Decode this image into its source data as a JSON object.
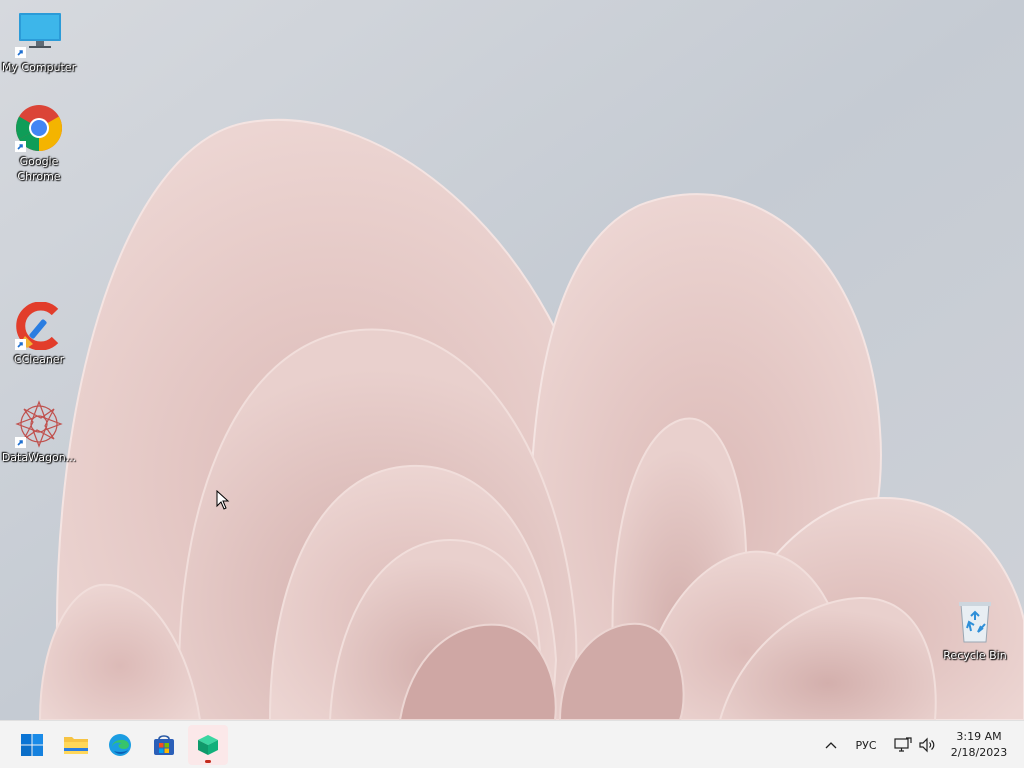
{
  "desktop": {
    "icons": [
      {
        "label": "My Computer",
        "icon": "monitor-icon"
      },
      {
        "label": "Google Chrome",
        "icon": "chrome-icon"
      },
      {
        "label": "CCleaner",
        "icon": "ccleaner-icon"
      },
      {
        "label": "DataWagon...",
        "icon": "datawagon-icon"
      },
      {
        "label": "Recycle Bin",
        "icon": "recycle-bin-icon"
      }
    ]
  },
  "taskbar": {
    "pinned": [
      {
        "name": "start",
        "icon": "windows-start-icon"
      },
      {
        "name": "file-explorer",
        "icon": "folder-icon"
      },
      {
        "name": "edge",
        "icon": "edge-icon"
      },
      {
        "name": "store",
        "icon": "store-icon"
      },
      {
        "name": "running-app",
        "icon": "green-cube-icon",
        "active": true
      }
    ],
    "tray": {
      "language": "РУС",
      "time": "3:19 AM",
      "date": "2/18/2023"
    }
  },
  "colors": {
    "accent": "#0067c0",
    "taskbar_bg": "#f3f3f3",
    "wallpaper_petal": "#e6c9c6",
    "wallpaper_bg": "#c9ced6"
  }
}
